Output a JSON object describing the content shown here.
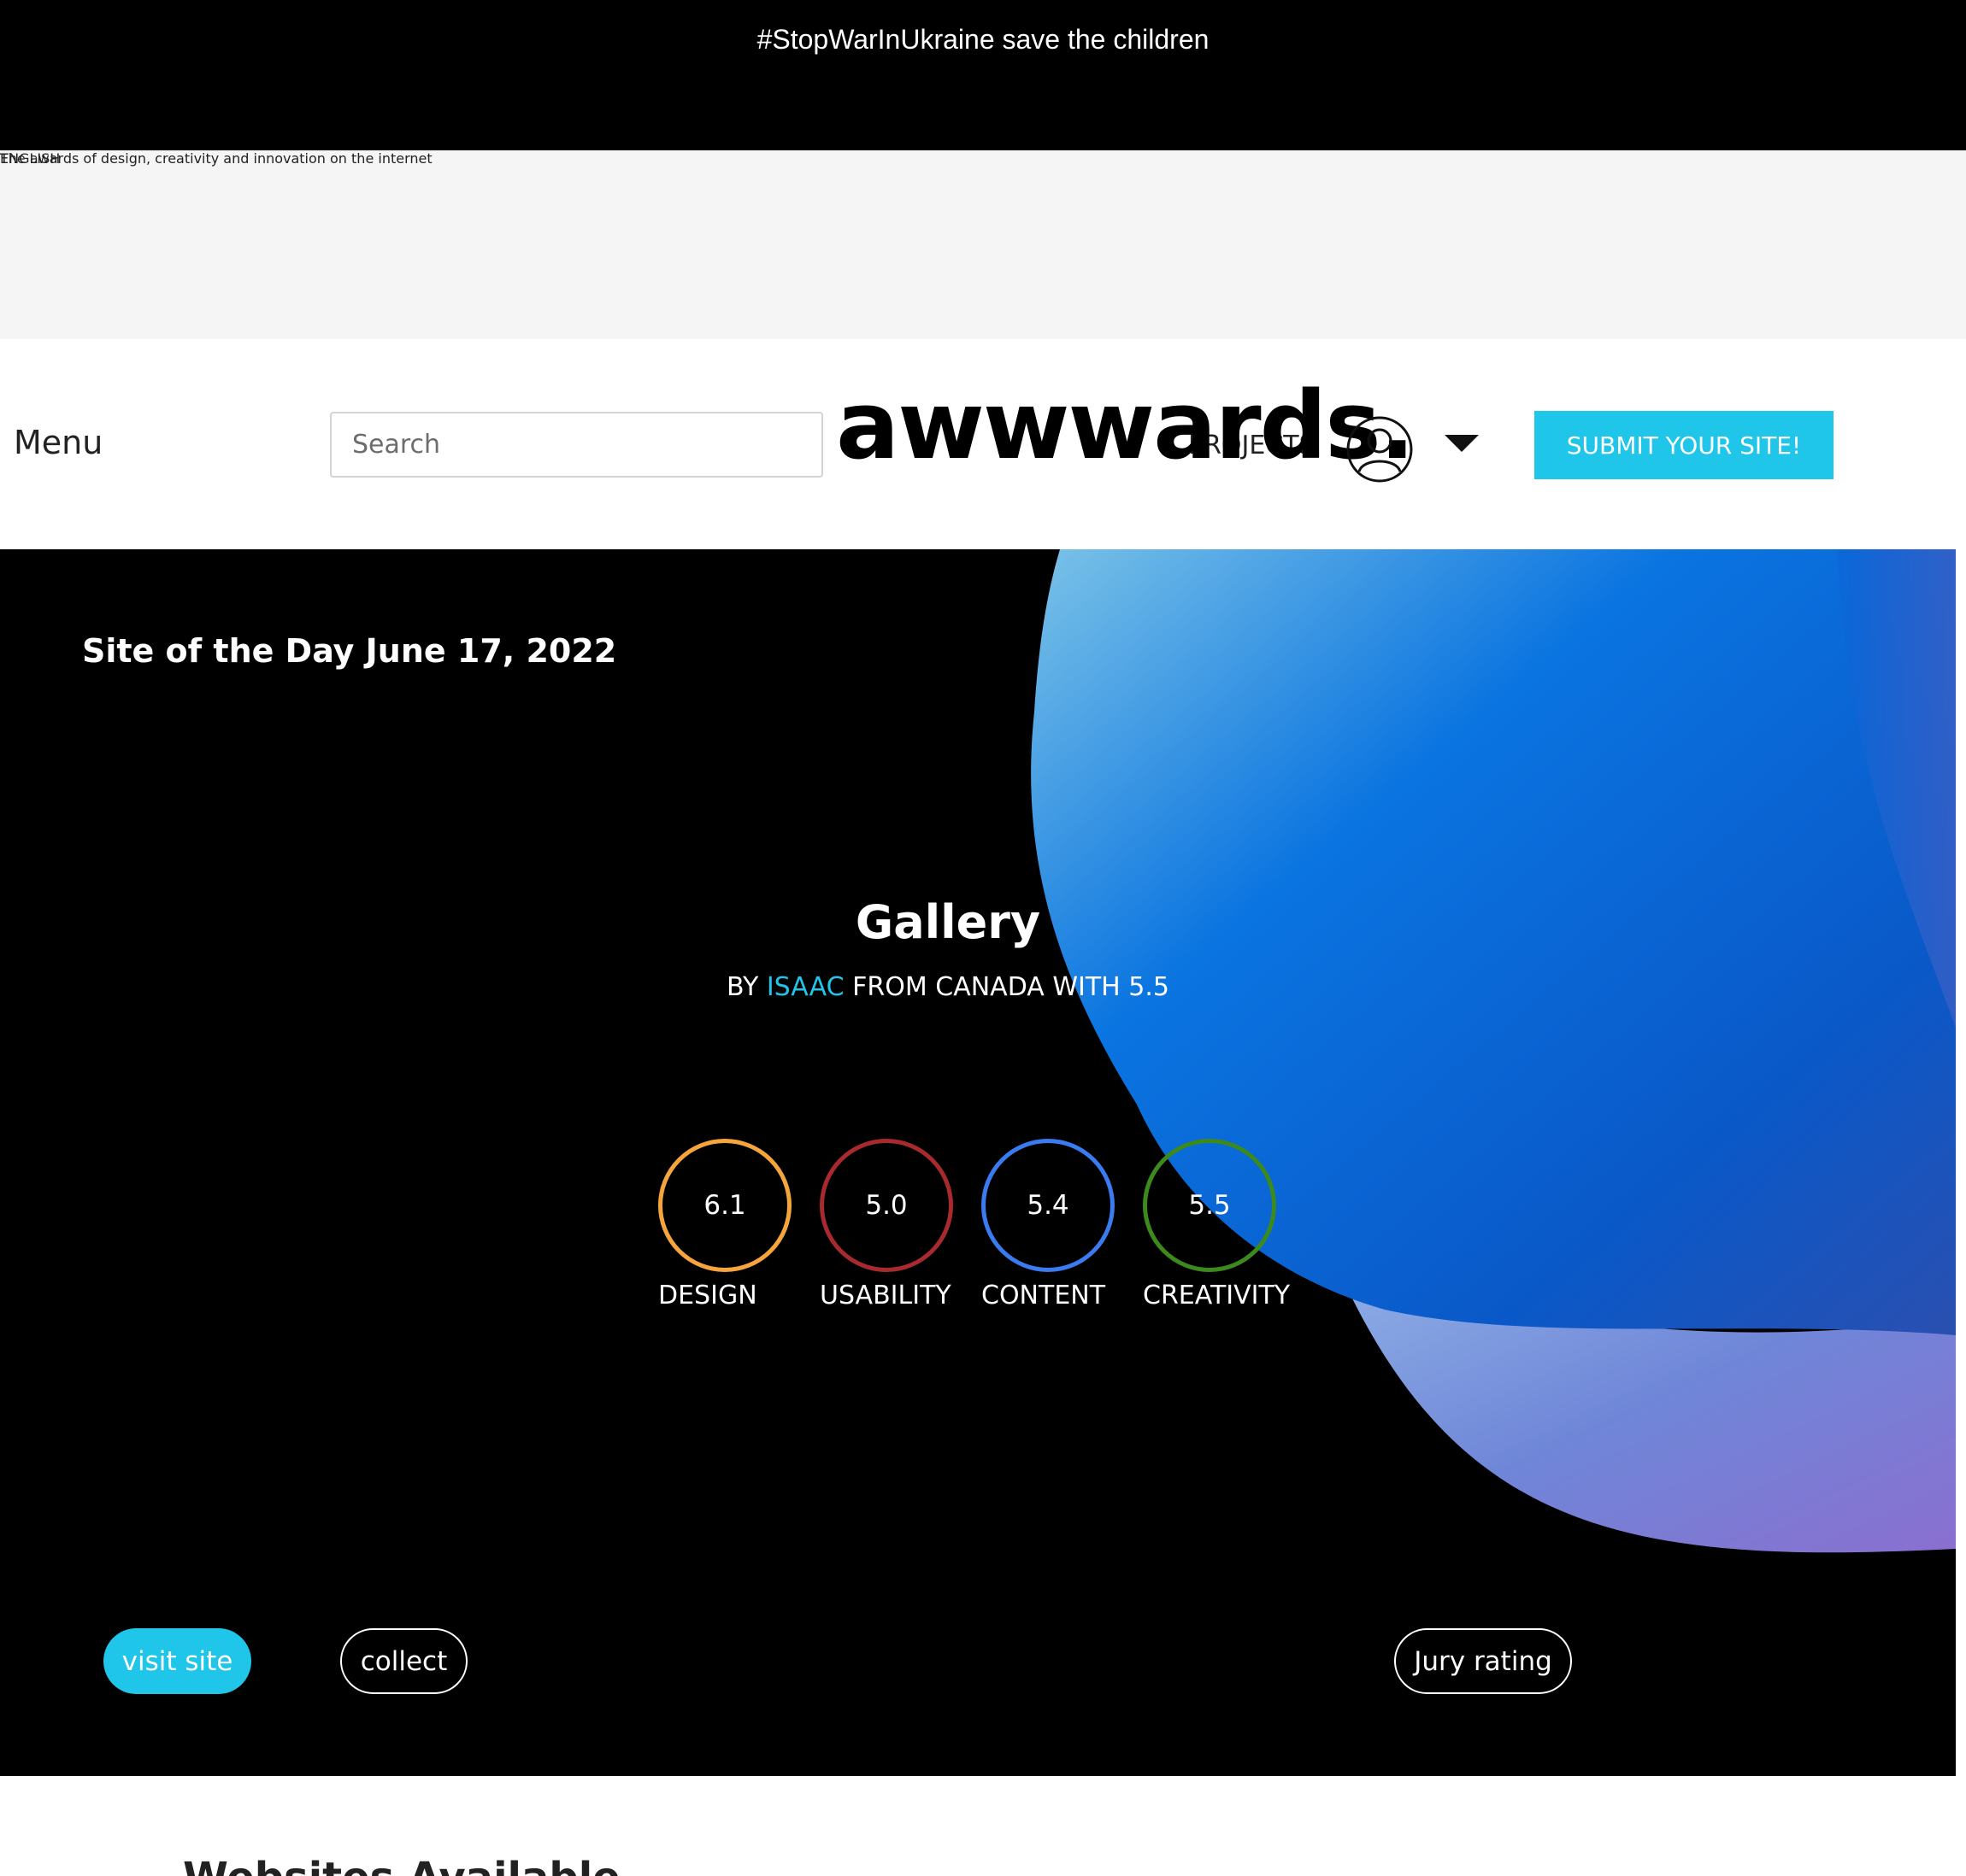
{
  "banner": {
    "message": "#StopWarInUkraine save the children"
  },
  "subbar": {
    "language": "ENGLISH",
    "tagline": "The awards of design, creativity and innovation on the internet"
  },
  "header": {
    "menu_label": "Menu",
    "search_placeholder": "Search",
    "logo_text": "awwwards.",
    "projects_label": "PROJECTS",
    "submit_label": "SUBMIT YOUR SITE!",
    "user_icon": "user-icon",
    "caret_icon": "chevron-down-icon"
  },
  "hero": {
    "heading": "Site of the Day June 17, 2022",
    "title": "Gallery",
    "byline": {
      "by": "BY",
      "author": "ISAAC",
      "rest": "FROM CANADA WITH 5.5"
    },
    "scores": [
      {
        "label": "DESIGN",
        "value": "6.1",
        "color": "#f6a53d"
      },
      {
        "label": "USABILITY",
        "value": "5.0",
        "color": "#a82a2f"
      },
      {
        "label": "CONTENT",
        "value": "5.4",
        "color": "#3a7bf0"
      },
      {
        "label": "CREATIVITY",
        "value": "5.5",
        "color": "#3c8a1c"
      }
    ],
    "buttons": {
      "visit": "visit site",
      "collect": "collect",
      "jury": "Jury rating"
    }
  },
  "next_section": {
    "heading": "Websites Available"
  },
  "colors": {
    "accent": "#1fc6ea",
    "banner_bg": "#000000",
    "subbar_bg": "#f4f5f4"
  }
}
